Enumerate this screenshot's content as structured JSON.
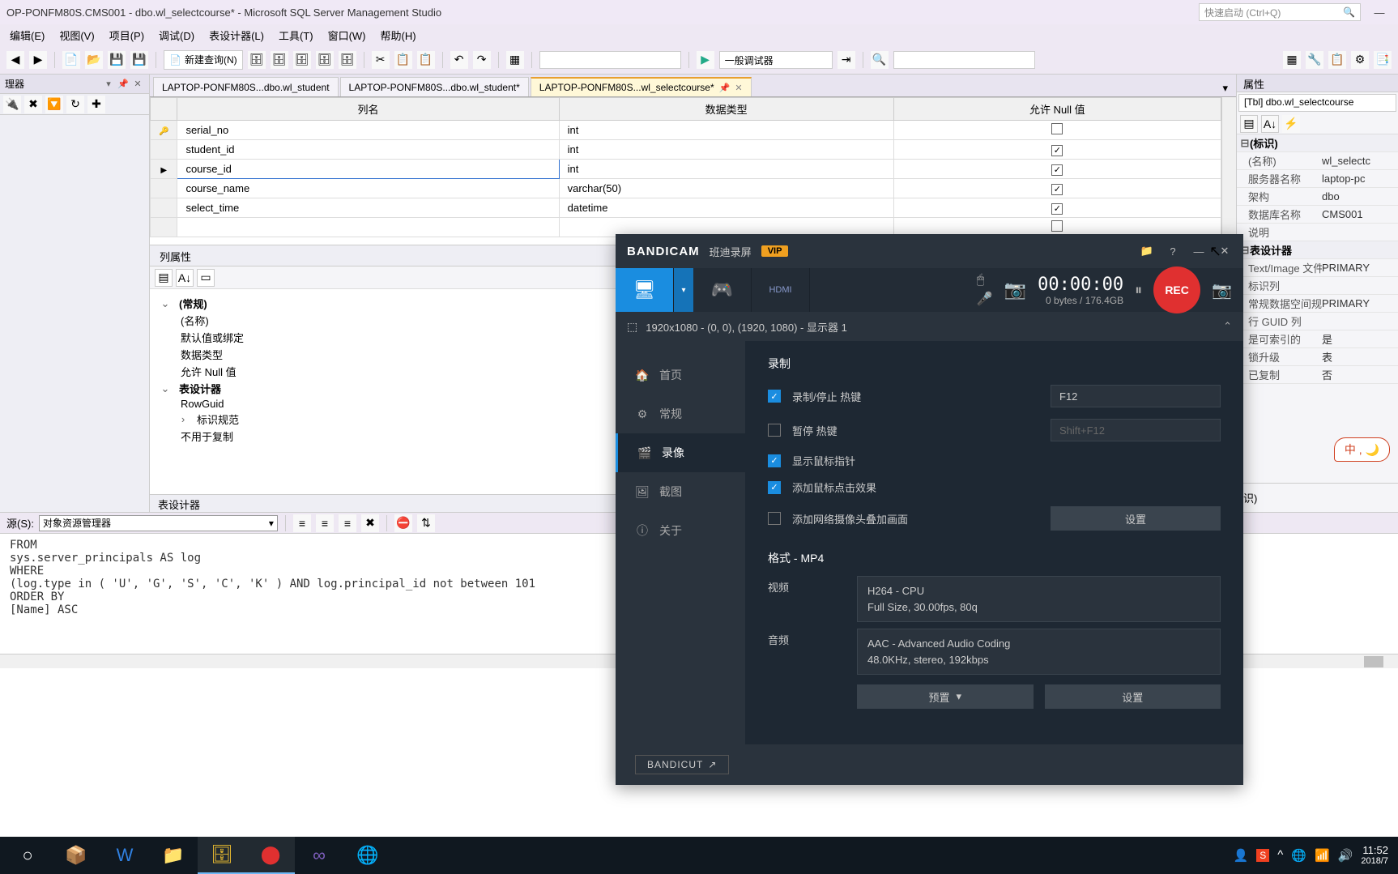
{
  "title_bar": {
    "text": "OP-PONFM80S.CMS001 - dbo.wl_selectcourse* - Microsoft SQL Server Management Studio"
  },
  "quick_launch": {
    "placeholder": "快速启动 (Ctrl+Q)"
  },
  "menus": {
    "edit": "编辑(E)",
    "view": "视图(V)",
    "project": "项目(P)",
    "debug": "调试(D)",
    "designer": "表设计器(L)",
    "tools": "工具(T)",
    "window": "窗口(W)",
    "help": "帮助(H)"
  },
  "toolbar": {
    "new_query": "新建查询(N)",
    "debug_combo": "一般调试器"
  },
  "left_panel": {
    "title": "理器"
  },
  "tabs": {
    "t1": "LAPTOP-PONFM80S...dbo.wl_student",
    "t2": "LAPTOP-PONFM80S...dbo.wl_student*",
    "t3": "LAPTOP-PONFM80S...wl_selectcourse*"
  },
  "grid": {
    "h_col": "列名",
    "h_type": "数据类型",
    "h_null": "允许 Null 值",
    "rows": [
      {
        "name": "serial_no",
        "type": "int",
        "nul": false,
        "key": true
      },
      {
        "name": "student_id",
        "type": "int",
        "nul": true
      },
      {
        "name": "course_id",
        "type": "int",
        "nul": true,
        "current": true
      },
      {
        "name": "course_name",
        "type": "varchar(50)",
        "nul": true
      },
      {
        "name": "select_time",
        "type": "datetime",
        "nul": true
      }
    ]
  },
  "col_props": {
    "title": "列属性",
    "group_general": "(常规)",
    "p_name": "(名称)",
    "p_default": "默认值或绑定",
    "p_type": "数据类型",
    "p_null": "允许 Null 值",
    "group_designer": "表设计器",
    "p_rowguid": "RowGuid",
    "p_identity": "标识规范",
    "p_notcopy": "不用于复制",
    "status": "表设计器"
  },
  "properties": {
    "header": "属性",
    "object": "[Tbl] dbo.wl_selectcourse",
    "cat_identity": "(标识)",
    "p_name_l": "(名称)",
    "p_name_v": "wl_selectc",
    "p_server_l": "服务器名称",
    "p_server_v": "laptop-pc",
    "p_schema_l": "架构",
    "p_schema_v": "dbo",
    "p_db_l": "数据库名称",
    "p_db_v": "CMS001",
    "p_desc_l": "说明",
    "p_desc_v": "",
    "cat_designer": "表设计器",
    "p_textimg_l": "Text/Image 文件组",
    "p_textimg_v": "PRIMARY",
    "p_identcol_l": "标识列",
    "p_identcol_v": "",
    "p_regspace_l": "常规数据空间规范",
    "p_regspace_v": "PRIMARY",
    "p_guidcol_l": "行 GUID 列",
    "p_guidcol_v": "",
    "p_indexable_l": "是可索引的",
    "p_indexable_v": "是",
    "p_lockesc_l": "锁升级",
    "p_lockesc_v": "表",
    "p_replicate_l": "已复制",
    "p_replicate_v": "否",
    "footer": "识)"
  },
  "output": {
    "source_label": "源(S):",
    "source_value": "对象资源管理器",
    "text": "FROM\nsys.server_principals AS log\nWHERE\n(log.type in ( 'U', 'G', 'S', 'C', 'K' ) AND log.principal_id not between 101\nORDER BY\n[Name] ASC"
  },
  "bandicam": {
    "logo": "BANDICAM",
    "sub": "班迪录屏",
    "vip": "VIP",
    "timer": "00:00:00",
    "size": "0 bytes / 176.4GB",
    "rec": "REC",
    "resolution": "1920x1080 - (0, 0), (1920, 1080) - 显示器 1",
    "nav": {
      "home": "首页",
      "general": "常规",
      "video": "录像",
      "image": "截图",
      "about": "关于"
    },
    "section_rec": "录制",
    "s_rec_hotkey": "录制/停止 热键",
    "s_rec_hotkey_v": "F12",
    "s_pause_hotkey": "暂停 热键",
    "s_pause_hotkey_v": "Shift+F12",
    "s_cursor": "显示鼠标指针",
    "s_click": "添加鼠标点击效果",
    "s_webcam": "添加网络摄像头叠加画面",
    "btn_settings": "设置",
    "format_title": "格式 - MP4",
    "f_video_l": "视频",
    "f_video_v1": "H264 - CPU",
    "f_video_v2": "Full Size, 30.00fps, 80q",
    "f_audio_l": "音频",
    "f_audio_v1": "AAC - Advanced Audio Coding",
    "f_audio_v2": "48.0KHz, stereo, 192kbps",
    "btn_preset": "预置",
    "bandicut": "BANDICUT"
  },
  "ime": "中 , 🌙",
  "taskbar": {
    "time": "11:52",
    "date": "2018/7"
  }
}
